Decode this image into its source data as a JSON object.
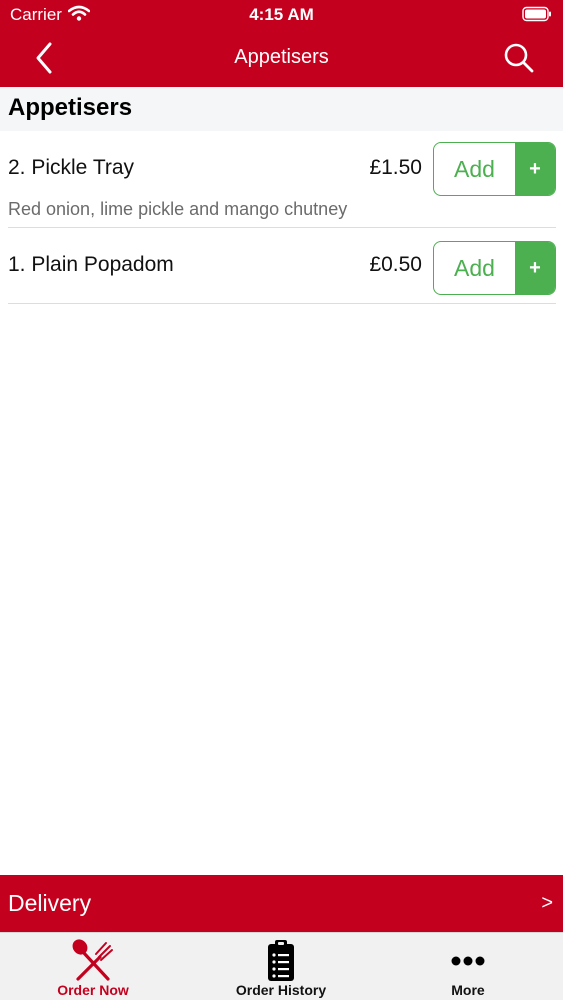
{
  "status_bar": {
    "carrier": "Carrier",
    "time": "4:15 AM"
  },
  "nav": {
    "title": "Appetisers"
  },
  "section": {
    "title": "Appetisers"
  },
  "items": [
    {
      "name": "2. Pickle Tray",
      "price": "£1.50",
      "description": "Red onion, lime pickle and mango chutney",
      "add_label": "Add",
      "plus_label": "+"
    },
    {
      "name": "1. Plain Popadom",
      "price": "£0.50",
      "add_label": "Add",
      "plus_label": "+"
    }
  ],
  "delivery": {
    "label": "Delivery",
    "arrow": ">"
  },
  "tabs": [
    {
      "label": "Order Now",
      "icon": "fork-knife-icon",
      "active": true
    },
    {
      "label": "Order History",
      "icon": "clipboard-list-icon",
      "active": false
    },
    {
      "label": "More",
      "icon": "more-dots-icon",
      "active": false
    }
  ],
  "colors": {
    "brand": "#c4001f",
    "accent_green": "#4caf50",
    "muted_text": "#6b6b6b"
  }
}
